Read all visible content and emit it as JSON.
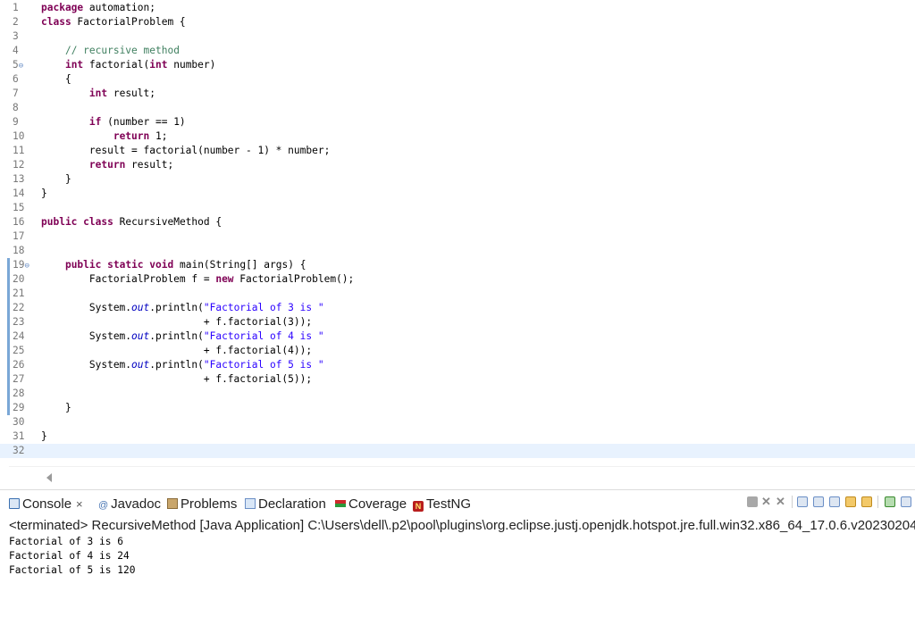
{
  "editor": {
    "lines": [
      {
        "n": "1",
        "tokens": [
          {
            "t": "kw",
            "v": "package"
          },
          {
            "t": "p",
            "v": " automation;"
          }
        ]
      },
      {
        "n": "2",
        "tokens": [
          {
            "t": "kw",
            "v": "class"
          },
          {
            "t": "p",
            "v": " FactorialProblem {"
          }
        ]
      },
      {
        "n": "3",
        "tokens": []
      },
      {
        "n": "4",
        "tokens": [
          {
            "t": "p",
            "v": "    "
          },
          {
            "t": "cm",
            "v": "// recursive method"
          }
        ]
      },
      {
        "n": "5",
        "fold": true,
        "tokens": [
          {
            "t": "p",
            "v": "    "
          },
          {
            "t": "kw",
            "v": "int"
          },
          {
            "t": "p",
            "v": " factorial("
          },
          {
            "t": "kw",
            "v": "int"
          },
          {
            "t": "p",
            "v": " number)"
          }
        ]
      },
      {
        "n": "6",
        "tokens": [
          {
            "t": "p",
            "v": "    {"
          }
        ]
      },
      {
        "n": "7",
        "tokens": [
          {
            "t": "p",
            "v": "        "
          },
          {
            "t": "kw",
            "v": "int"
          },
          {
            "t": "p",
            "v": " result;"
          }
        ]
      },
      {
        "n": "8",
        "tokens": []
      },
      {
        "n": "9",
        "tokens": [
          {
            "t": "p",
            "v": "        "
          },
          {
            "t": "kw",
            "v": "if"
          },
          {
            "t": "p",
            "v": " (number == 1)"
          }
        ]
      },
      {
        "n": "10",
        "tokens": [
          {
            "t": "p",
            "v": "            "
          },
          {
            "t": "kw",
            "v": "return"
          },
          {
            "t": "p",
            "v": " 1;"
          }
        ]
      },
      {
        "n": "11",
        "tokens": [
          {
            "t": "p",
            "v": "        result = factorial(number - 1) * number;"
          }
        ]
      },
      {
        "n": "12",
        "tokens": [
          {
            "t": "p",
            "v": "        "
          },
          {
            "t": "kw",
            "v": "return"
          },
          {
            "t": "p",
            "v": " result;"
          }
        ]
      },
      {
        "n": "13",
        "tokens": [
          {
            "t": "p",
            "v": "    }"
          }
        ]
      },
      {
        "n": "14",
        "tokens": [
          {
            "t": "p",
            "v": "}"
          }
        ]
      },
      {
        "n": "15",
        "tokens": []
      },
      {
        "n": "16",
        "tokens": [
          {
            "t": "kw",
            "v": "public"
          },
          {
            "t": "p",
            "v": " "
          },
          {
            "t": "kw",
            "v": "class"
          },
          {
            "t": "p",
            "v": " RecursiveMethod {"
          }
        ]
      },
      {
        "n": "17",
        "tokens": []
      },
      {
        "n": "18",
        "tokens": []
      },
      {
        "n": "19",
        "fold": true,
        "tokens": [
          {
            "t": "p",
            "v": "    "
          },
          {
            "t": "kw",
            "v": "public"
          },
          {
            "t": "p",
            "v": " "
          },
          {
            "t": "kw",
            "v": "static"
          },
          {
            "t": "p",
            "v": " "
          },
          {
            "t": "kw",
            "v": "void"
          },
          {
            "t": "p",
            "v": " main(String[] args) {"
          }
        ]
      },
      {
        "n": "20",
        "tokens": [
          {
            "t": "p",
            "v": "        FactorialProblem f = "
          },
          {
            "t": "kw",
            "v": "new"
          },
          {
            "t": "p",
            "v": " FactorialProblem();"
          }
        ]
      },
      {
        "n": "21",
        "tokens": []
      },
      {
        "n": "22",
        "tokens": [
          {
            "t": "p",
            "v": "        System."
          },
          {
            "t": "fld",
            "v": "out"
          },
          {
            "t": "p",
            "v": ".println("
          },
          {
            "t": "str",
            "v": "\"Factorial of 3 is \""
          }
        ]
      },
      {
        "n": "23",
        "tokens": [
          {
            "t": "p",
            "v": "                           + f.factorial(3));"
          }
        ]
      },
      {
        "n": "24",
        "tokens": [
          {
            "t": "p",
            "v": "        System."
          },
          {
            "t": "fld",
            "v": "out"
          },
          {
            "t": "p",
            "v": ".println("
          },
          {
            "t": "str",
            "v": "\"Factorial of 4 is \""
          }
        ]
      },
      {
        "n": "25",
        "tokens": [
          {
            "t": "p",
            "v": "                           + f.factorial(4));"
          }
        ]
      },
      {
        "n": "26",
        "tokens": [
          {
            "t": "p",
            "v": "        System."
          },
          {
            "t": "fld",
            "v": "out"
          },
          {
            "t": "p",
            "v": ".println("
          },
          {
            "t": "str",
            "v": "\"Factorial of 5 is \""
          }
        ]
      },
      {
        "n": "27",
        "tokens": [
          {
            "t": "p",
            "v": "                           + f.factorial(5));"
          }
        ]
      },
      {
        "n": "28",
        "tokens": []
      },
      {
        "n": "29",
        "tokens": [
          {
            "t": "p",
            "v": "    }"
          }
        ]
      },
      {
        "n": "30",
        "tokens": []
      },
      {
        "n": "31",
        "tokens": [
          {
            "t": "p",
            "v": "}"
          }
        ]
      },
      {
        "n": "32",
        "current": true,
        "tokens": []
      }
    ]
  },
  "console": {
    "tabs": {
      "console": "Console",
      "javadoc": "Javadoc",
      "problems": "Problems",
      "declaration": "Declaration",
      "coverage": "Coverage",
      "testng": "TestNG"
    },
    "tab_icons": {
      "javadoc_glyph": "@",
      "testng_glyph": "N"
    },
    "close_glyph": "×",
    "status": "<terminated> RecursiveMethod [Java Application] C:\\Users\\dell\\.p2\\pool\\plugins\\org.eclipse.justj.openjdk.hotspot.jre.full.win32.x86_64_17.0.6.v20230204",
    "output": [
      "Factorial of 3 is 6",
      "Factorial of 4 is 24",
      "Factorial of 5 is 120"
    ]
  }
}
